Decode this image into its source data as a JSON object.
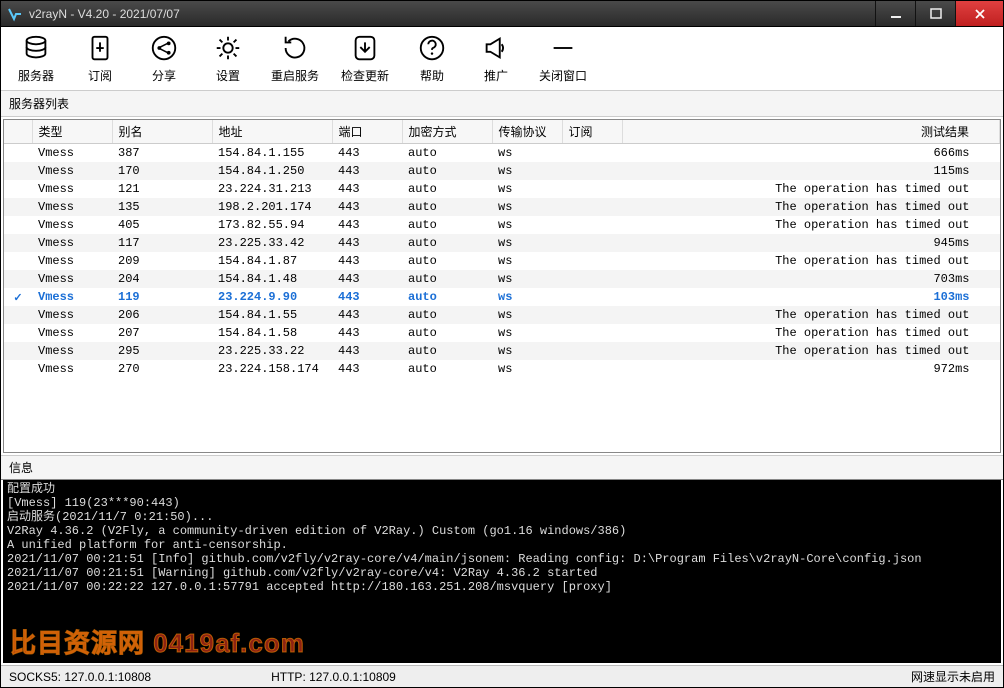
{
  "window": {
    "title": "v2rayN - V4.20 - 2021/07/07"
  },
  "toolbar": {
    "server": "服务器",
    "subscribe": "订阅",
    "share": "分享",
    "settings": "设置",
    "restart": "重启服务",
    "update": "检查更新",
    "help": "帮助",
    "promo": "推广",
    "close": "关闭窗口"
  },
  "labels": {
    "server_list": "服务器列表",
    "info": "信息"
  },
  "columns": {
    "type": "类型",
    "alias": "别名",
    "address": "地址",
    "port": "端口",
    "encryption": "加密方式",
    "transport": "传输协议",
    "sub": "订阅",
    "result": "测试结果"
  },
  "rows": [
    {
      "type": "Vmess",
      "alias": "387",
      "addr": "154.84.1.155",
      "port": "443",
      "enc": "auto",
      "trans": "ws",
      "sub": "",
      "result": "666ms",
      "active": false
    },
    {
      "type": "Vmess",
      "alias": "170",
      "addr": "154.84.1.250",
      "port": "443",
      "enc": "auto",
      "trans": "ws",
      "sub": "",
      "result": "115ms",
      "active": false
    },
    {
      "type": "Vmess",
      "alias": "121",
      "addr": "23.224.31.213",
      "port": "443",
      "enc": "auto",
      "trans": "ws",
      "sub": "",
      "result": "The operation has timed out",
      "active": false
    },
    {
      "type": "Vmess",
      "alias": "135",
      "addr": "198.2.201.174",
      "port": "443",
      "enc": "auto",
      "trans": "ws",
      "sub": "",
      "result": "The operation has timed out",
      "active": false
    },
    {
      "type": "Vmess",
      "alias": "405",
      "addr": "173.82.55.94",
      "port": "443",
      "enc": "auto",
      "trans": "ws",
      "sub": "",
      "result": "The operation has timed out",
      "active": false
    },
    {
      "type": "Vmess",
      "alias": "117",
      "addr": "23.225.33.42",
      "port": "443",
      "enc": "auto",
      "trans": "ws",
      "sub": "",
      "result": "945ms",
      "active": false
    },
    {
      "type": "Vmess",
      "alias": "209",
      "addr": "154.84.1.87",
      "port": "443",
      "enc": "auto",
      "trans": "ws",
      "sub": "",
      "result": "The operation has timed out",
      "active": false
    },
    {
      "type": "Vmess",
      "alias": "204",
      "addr": "154.84.1.48",
      "port": "443",
      "enc": "auto",
      "trans": "ws",
      "sub": "",
      "result": "703ms",
      "active": false
    },
    {
      "type": "Vmess",
      "alias": "119",
      "addr": "23.224.9.90",
      "port": "443",
      "enc": "auto",
      "trans": "ws",
      "sub": "",
      "result": "103ms",
      "active": true
    },
    {
      "type": "Vmess",
      "alias": "206",
      "addr": "154.84.1.55",
      "port": "443",
      "enc": "auto",
      "trans": "ws",
      "sub": "",
      "result": "The operation has timed out",
      "active": false
    },
    {
      "type": "Vmess",
      "alias": "207",
      "addr": "154.84.1.58",
      "port": "443",
      "enc": "auto",
      "trans": "ws",
      "sub": "",
      "result": "The operation has timed out",
      "active": false
    },
    {
      "type": "Vmess",
      "alias": "295",
      "addr": "23.225.33.22",
      "port": "443",
      "enc": "auto",
      "trans": "ws",
      "sub": "",
      "result": "The operation has timed out",
      "active": false
    },
    {
      "type": "Vmess",
      "alias": "270",
      "addr": "23.224.158.174",
      "port": "443",
      "enc": "auto",
      "trans": "ws",
      "sub": "",
      "result": "972ms",
      "active": false
    }
  ],
  "console": [
    "配置成功",
    "[Vmess] 119(23***90:443)",
    "启动服务(2021/11/7 0:21:50)...",
    "V2Ray 4.36.2 (V2Fly, a community-driven edition of V2Ray.) Custom (go1.16 windows/386)",
    "A unified platform for anti-censorship.",
    "2021/11/07 00:21:51 [Info] github.com/v2fly/v2ray-core/v4/main/jsonem: Reading config: D:\\Program Files\\v2rayN-Core\\config.json",
    "2021/11/07 00:21:51 [Warning] github.com/v2fly/v2ray-core/v4: V2Ray 4.36.2 started",
    "2021/11/07 00:22:22 127.0.0.1:57791 accepted http://180.163.251.208/msvquery [proxy]"
  ],
  "status": {
    "socks": "SOCKS5:  127.0.0.1:10808",
    "http": "HTTP:  127.0.0.1:10809",
    "net": "网速显示未启用"
  },
  "watermark": "比目资源网  0419af.com"
}
